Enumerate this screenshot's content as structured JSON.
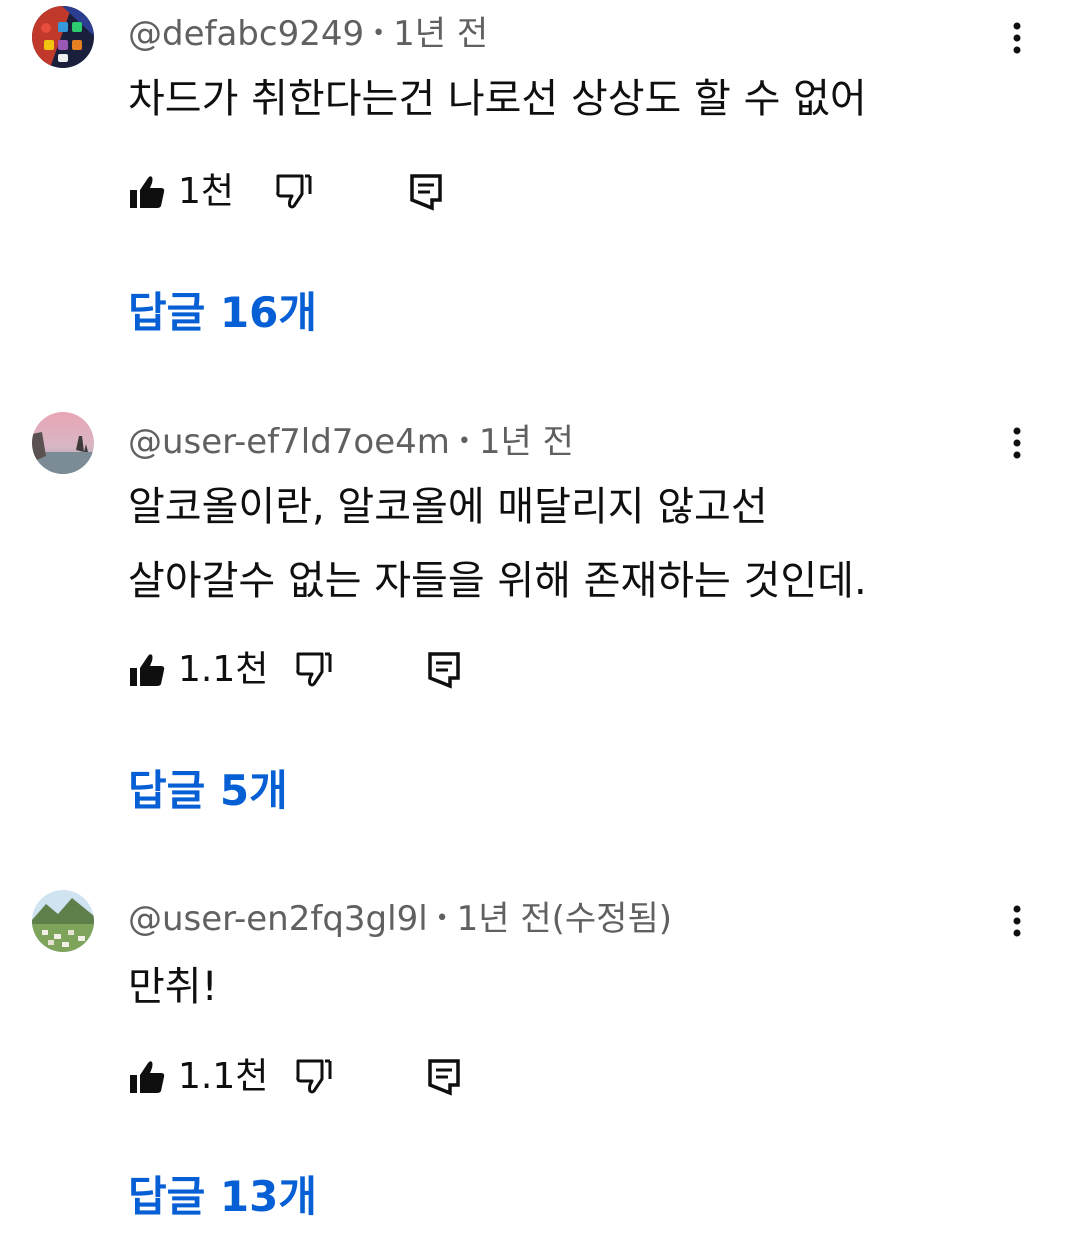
{
  "comments": [
    {
      "author": "@defabc9249",
      "separator": "•",
      "time": "1년 전",
      "text": "차드가 취한다는건 나로선 상상도 할 수 없어",
      "likes": "1천",
      "replies": "답글 16개",
      "avatar": "phone-homescreen-avatar"
    },
    {
      "author": "@user-ef7ld7oe4m",
      "separator": "•",
      "time": "1년 전",
      "text": "알코올이란, 알코올에 매달리지 않고선\n살아갈수 없는 자들을 위해 존재하는 것인데.",
      "likes": "1.1천",
      "replies": "답글 5개",
      "avatar": "sunset-sea-rocks-avatar"
    },
    {
      "author": "@user-en2fq3gl9l",
      "separator": "•",
      "time": "1년 전(수정됨)",
      "text": "만취!",
      "likes": "1.1천",
      "replies": "답글 13개",
      "avatar": "mountain-village-avatar"
    }
  ],
  "icons": {
    "like": "thumb-up-filled-icon",
    "dislike": "thumb-down-outline-icon",
    "reply": "comment-reply-icon",
    "more": "more-vert-icon"
  },
  "colors": {
    "link": "#065fd4",
    "meta": "#606060",
    "text": "#0f0f0f"
  }
}
